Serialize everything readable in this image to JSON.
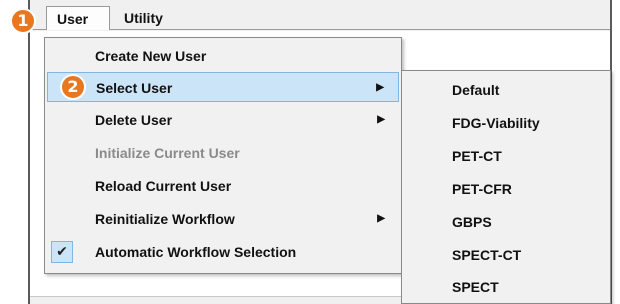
{
  "menubar": {
    "items": [
      {
        "label": "User"
      },
      {
        "label": "Utility"
      }
    ]
  },
  "callouts": {
    "badge1": "1",
    "badge2": "2"
  },
  "user_menu": {
    "items": [
      {
        "label": "Create New User",
        "has_submenu": false,
        "disabled": false
      },
      {
        "label": "Select User",
        "has_submenu": true,
        "disabled": false,
        "highlighted": true
      },
      {
        "label": "Delete User",
        "has_submenu": true,
        "disabled": false
      },
      {
        "label": "Initialize Current User",
        "has_submenu": false,
        "disabled": true
      },
      {
        "label": "Reload Current User",
        "has_submenu": false,
        "disabled": false
      },
      {
        "label": "Reinitialize Workflow",
        "has_submenu": true,
        "disabled": false
      },
      {
        "label": "Automatic Workflow Selection",
        "has_submenu": false,
        "disabled": false,
        "checked": true
      }
    ],
    "submenu_arrow": "▶",
    "check_mark": "✔"
  },
  "select_user_submenu": {
    "items": [
      {
        "label": "Default"
      },
      {
        "label": "FDG-Viability"
      },
      {
        "label": "PET-CT"
      },
      {
        "label": "PET-CFR"
      },
      {
        "label": "GBPS"
      },
      {
        "label": "SPECT-CT"
      },
      {
        "label": "SPECT"
      }
    ]
  },
  "colors": {
    "badge": "#e87722",
    "highlight": "#cce4f7",
    "highlight_border": "#7fb6e3",
    "disabled_text": "#8a8a8a"
  }
}
